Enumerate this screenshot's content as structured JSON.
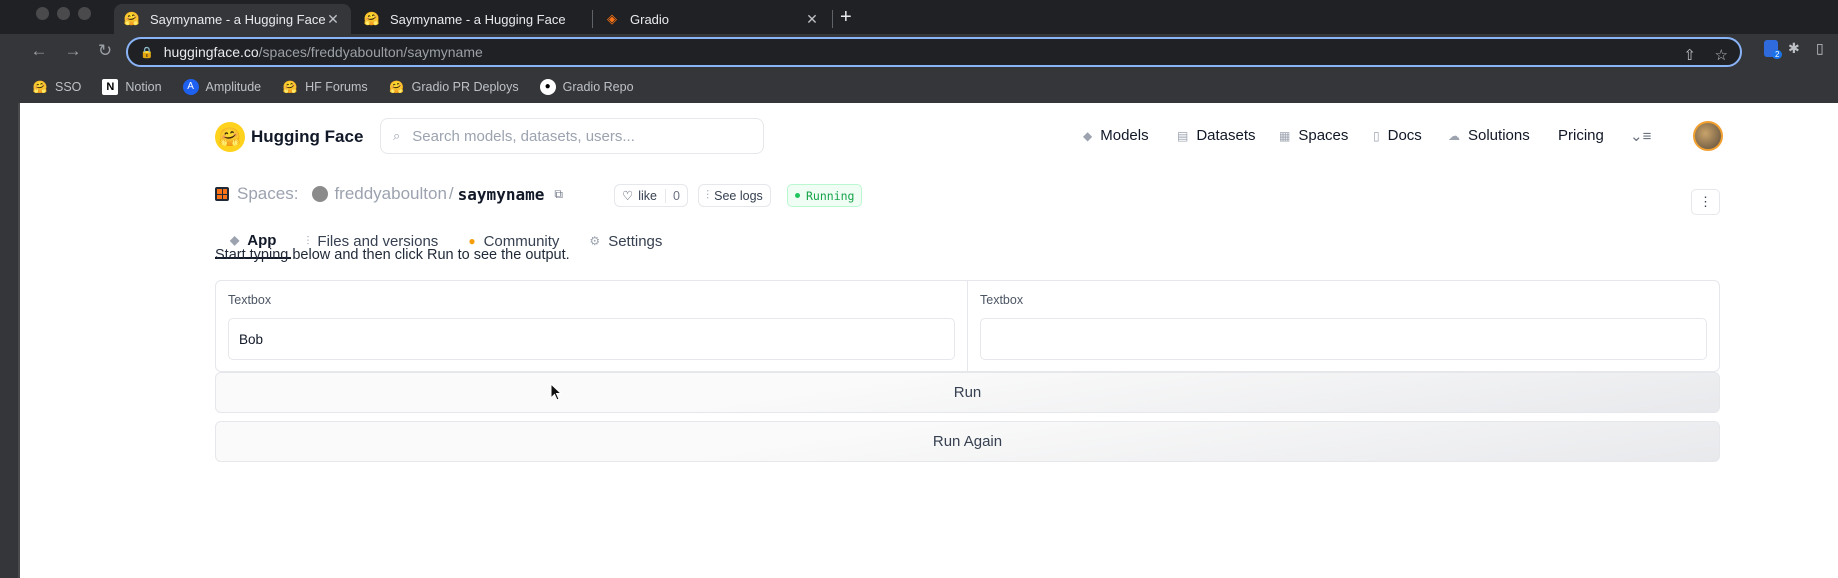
{
  "browser": {
    "tabs": [
      {
        "title": "Saymyname - a Hugging Face",
        "favicon": "hugging-face-emoji",
        "active": true
      },
      {
        "title": "Saymyname - a Hugging Face",
        "favicon": "hugging-face-emoji",
        "active": false
      },
      {
        "title": "Gradio",
        "favicon": "gradio-logo",
        "active": false
      }
    ],
    "url_host": "huggingface.co",
    "url_path": "/spaces/freddyaboulton/saymyname",
    "extension_badge": "2",
    "bookmarks": [
      {
        "label": "SSO",
        "icon": "hugging-face-emoji"
      },
      {
        "label": "Notion",
        "icon": "notion-logo"
      },
      {
        "label": "Amplitude",
        "icon": "amplitude-logo"
      },
      {
        "label": "HF Forums",
        "icon": "hugging-face-emoji"
      },
      {
        "label": "Gradio PR Deploys",
        "icon": "hugging-face-emoji"
      },
      {
        "label": "Gradio Repo",
        "icon": "github-logo"
      }
    ]
  },
  "header": {
    "brand": "Hugging Face",
    "search_placeholder": "Search models, datasets, users...",
    "nav": [
      {
        "label": "Models",
        "icon": "models-icon"
      },
      {
        "label": "Datasets",
        "icon": "datasets-icon"
      },
      {
        "label": "Spaces",
        "icon": "spaces-icon"
      },
      {
        "label": "Docs",
        "icon": "docs-icon"
      },
      {
        "label": "Solutions",
        "icon": "solutions-icon"
      },
      {
        "label": "Pricing",
        "icon": ""
      }
    ]
  },
  "space": {
    "section": "Spaces:",
    "owner": "freddyaboulton",
    "separator": "/",
    "name": "saymyname",
    "like_label": "like",
    "like_count": "0",
    "logs_label": "See logs",
    "status": "Running"
  },
  "tabs": [
    {
      "label": "App",
      "icon": "app-icon",
      "active": true
    },
    {
      "label": "Files and versions",
      "icon": "files-icon",
      "active": false
    },
    {
      "label": "Community",
      "icon": "community-icon",
      "active": false
    },
    {
      "label": "Settings",
      "icon": "gear-icon",
      "active": false
    }
  ],
  "app": {
    "instructions": "Start typing below and then click Run to see the output.",
    "input_label": "Textbox",
    "input_value": "Bob",
    "output_label": "Textbox",
    "output_value": "",
    "run_label": "Run",
    "run_again_label": "Run Again"
  },
  "colors": {
    "accent_yellow": "#ffd21e",
    "status_green": "#16a34a",
    "chrome_dark": "#35363a",
    "omnibox_focus": "#8ab4f8"
  }
}
